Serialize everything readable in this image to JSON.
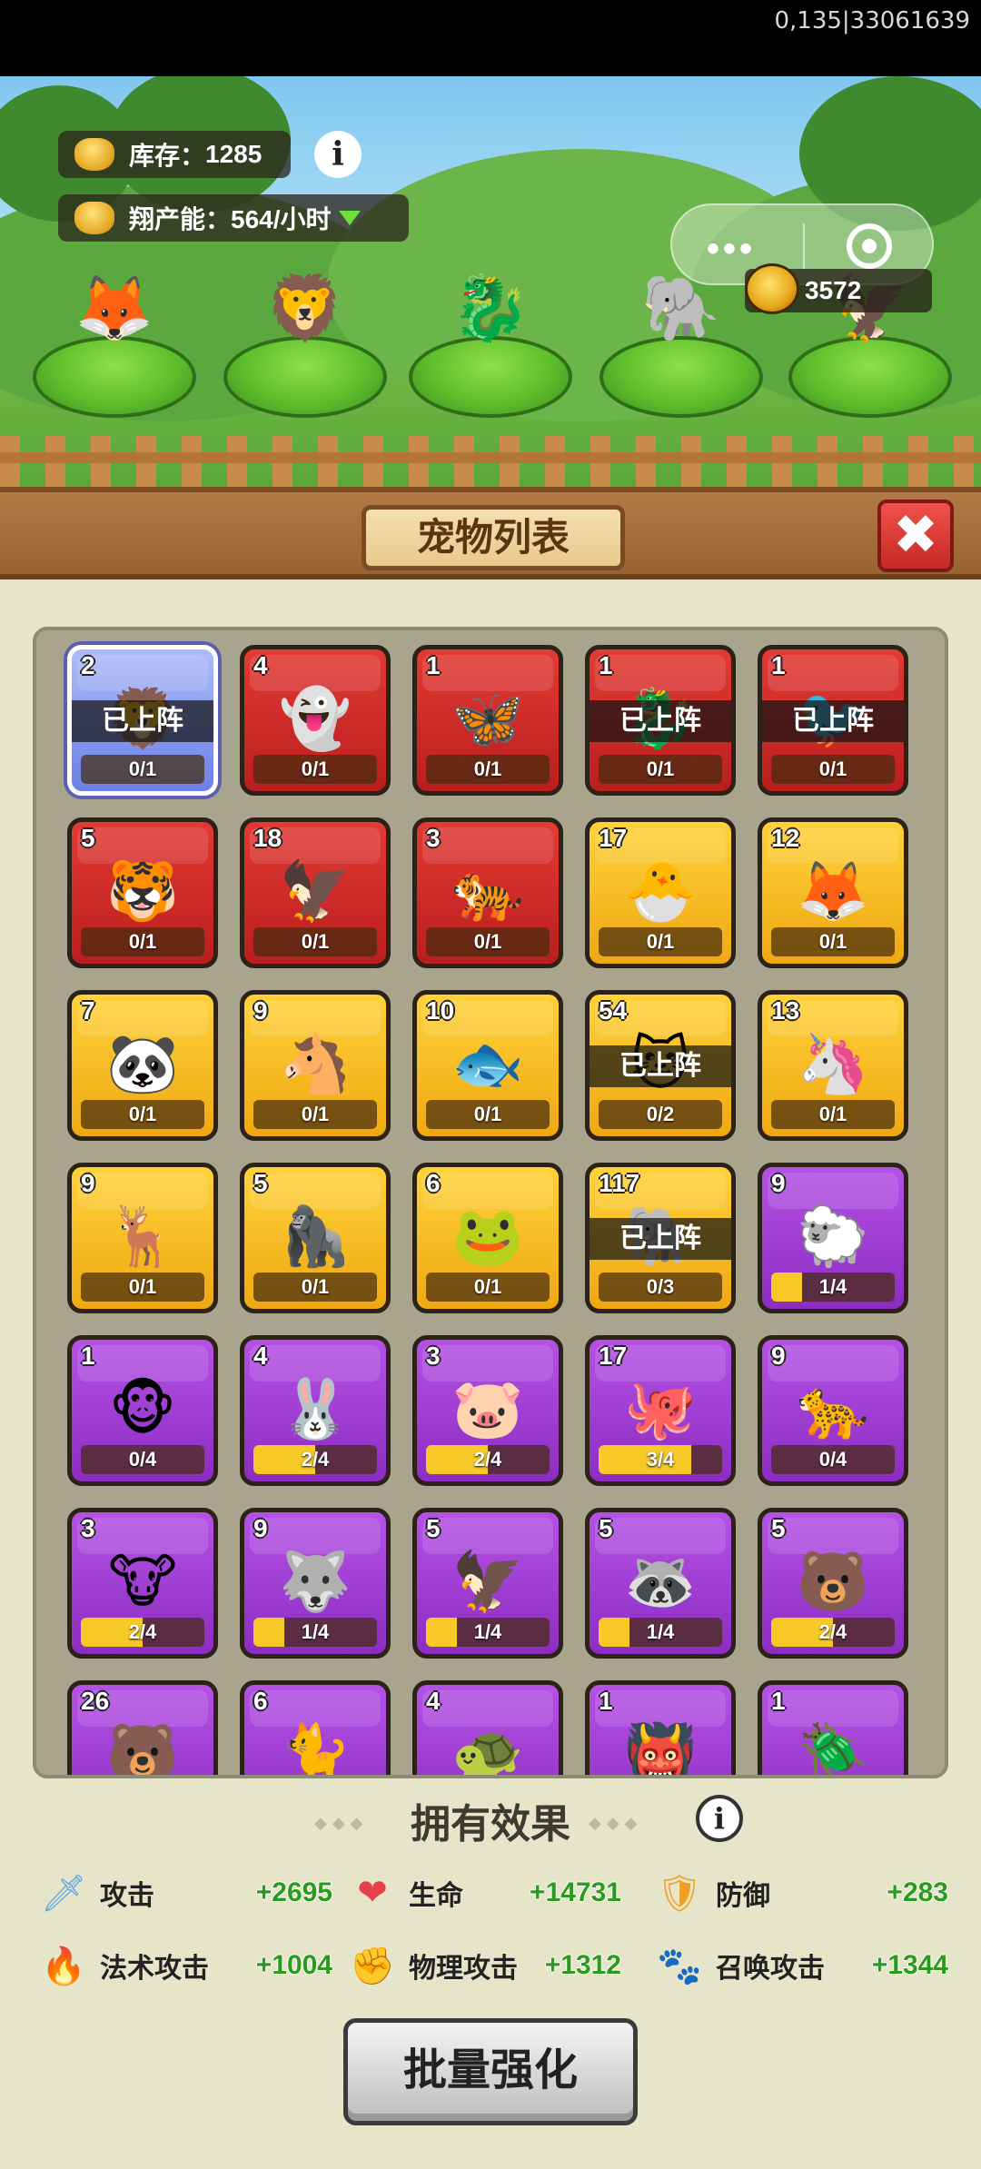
{
  "status_code": "0,135|33061639",
  "top": {
    "stock_label": "库存：",
    "stock_value": "1285",
    "capacity_label": "翔产能：",
    "capacity_value": "564/小时",
    "info_glyph": "i",
    "gold_value": "3572",
    "menu_dots": "•••"
  },
  "team": [
    {
      "icon": "fox-pet-icon",
      "glyph": "🦊"
    },
    {
      "icon": "lion-dance-pet-icon",
      "glyph": "🦁"
    },
    {
      "icon": "dragon-pet-icon",
      "glyph": "🐉"
    },
    {
      "icon": "elephant-pet-icon",
      "glyph": "🐘"
    },
    {
      "icon": "phoenix-pet-icon",
      "glyph": "🦅"
    }
  ],
  "panel": {
    "title": "宠物列表",
    "close_glyph": "✖"
  },
  "deployed_label": "已上阵",
  "pets": [
    {
      "level": "2",
      "progress": "0/1",
      "fill": 0.0,
      "color": "blue",
      "deployed": true,
      "icon": "lion-pet-icon",
      "glyph": "🦁"
    },
    {
      "level": "4",
      "progress": "0/1",
      "fill": 0.0,
      "color": "red",
      "deployed": false,
      "icon": "ghost-king-pet-icon",
      "glyph": "👻"
    },
    {
      "level": "1",
      "progress": "0/1",
      "fill": 0.0,
      "color": "red",
      "deployed": false,
      "icon": "butterfly-pet-icon",
      "glyph": "🦋"
    },
    {
      "level": "1",
      "progress": "0/1",
      "fill": 0.0,
      "color": "red",
      "deployed": true,
      "icon": "dragon-pet-icon",
      "glyph": "🐉"
    },
    {
      "level": "1",
      "progress": "0/1",
      "fill": 0.0,
      "color": "red",
      "deployed": true,
      "icon": "phoenix-pet-icon",
      "glyph": "🐦"
    },
    {
      "level": "5",
      "progress": "0/1",
      "fill": 0.0,
      "color": "red",
      "deployed": false,
      "icon": "beast-pet-icon",
      "glyph": "🐯"
    },
    {
      "level": "18",
      "progress": "0/1",
      "fill": 0.0,
      "color": "red",
      "deployed": false,
      "icon": "eagle-pet-icon",
      "glyph": "🦅"
    },
    {
      "level": "3",
      "progress": "0/1",
      "fill": 0.0,
      "color": "red",
      "deployed": false,
      "icon": "white-tiger-pet-icon",
      "glyph": "🐅"
    },
    {
      "level": "17",
      "progress": "0/1",
      "fill": 0.0,
      "color": "yellow",
      "deployed": false,
      "icon": "egg-chick-pet-icon",
      "glyph": "🐣"
    },
    {
      "level": "12",
      "progress": "0/1",
      "fill": 0.0,
      "color": "yellow",
      "deployed": false,
      "icon": "white-fox-pet-icon",
      "glyph": "🦊"
    },
    {
      "level": "7",
      "progress": "0/1",
      "fill": 0.0,
      "color": "yellow",
      "deployed": false,
      "icon": "panda-pet-icon",
      "glyph": "🐼"
    },
    {
      "level": "9",
      "progress": "0/1",
      "fill": 0.0,
      "color": "yellow",
      "deployed": false,
      "icon": "horse-pet-icon",
      "glyph": "🐴"
    },
    {
      "level": "10",
      "progress": "0/1",
      "fill": 0.0,
      "color": "yellow",
      "deployed": false,
      "icon": "fish-pet-icon",
      "glyph": "🐟"
    },
    {
      "level": "54",
      "progress": "0/2",
      "fill": 0.0,
      "color": "yellow",
      "deployed": true,
      "icon": "cat-pet-icon",
      "glyph": "🐱"
    },
    {
      "level": "13",
      "progress": "0/1",
      "fill": 0.0,
      "color": "yellow",
      "deployed": false,
      "icon": "unicorn-pet-icon",
      "glyph": "🦄"
    },
    {
      "level": "9",
      "progress": "0/1",
      "fill": 0.0,
      "color": "yellow",
      "deployed": false,
      "icon": "deer-pet-icon",
      "glyph": "🦌"
    },
    {
      "level": "5",
      "progress": "0/1",
      "fill": 0.0,
      "color": "yellow",
      "deployed": false,
      "icon": "gorilla-pet-icon",
      "glyph": "🦍"
    },
    {
      "level": "6",
      "progress": "0/1",
      "fill": 0.0,
      "color": "yellow",
      "deployed": false,
      "icon": "frog-pet-icon",
      "glyph": "🐸"
    },
    {
      "level": "117",
      "progress": "0/3",
      "fill": 0.0,
      "color": "yellow",
      "deployed": true,
      "icon": "elephant-pet-icon",
      "glyph": "🐘"
    },
    {
      "level": "9",
      "progress": "1/4",
      "fill": 0.25,
      "color": "purple",
      "deployed": false,
      "icon": "sheep-pet-icon",
      "glyph": "🐑"
    },
    {
      "level": "1",
      "progress": "0/4",
      "fill": 0.0,
      "color": "purple",
      "deployed": false,
      "icon": "monkey-pet-icon",
      "glyph": "🐵"
    },
    {
      "level": "4",
      "progress": "2/4",
      "fill": 0.5,
      "color": "purple",
      "deployed": false,
      "icon": "rabbit-pet-icon",
      "glyph": "🐰"
    },
    {
      "level": "3",
      "progress": "2/4",
      "fill": 0.5,
      "color": "purple",
      "deployed": false,
      "icon": "pig-pet-icon",
      "glyph": "🐷"
    },
    {
      "level": "17",
      "progress": "3/4",
      "fill": 0.75,
      "color": "purple",
      "deployed": false,
      "icon": "octopus-pet-icon",
      "glyph": "🐙"
    },
    {
      "level": "9",
      "progress": "0/4",
      "fill": 0.0,
      "color": "purple",
      "deployed": false,
      "icon": "leopard-pet-icon",
      "glyph": "🐆"
    },
    {
      "level": "3",
      "progress": "2/4",
      "fill": 0.5,
      "color": "purple",
      "deployed": false,
      "icon": "ox-pet-icon",
      "glyph": "🐮"
    },
    {
      "level": "9",
      "progress": "1/4",
      "fill": 0.25,
      "color": "purple",
      "deployed": false,
      "icon": "wolf-pet-icon",
      "glyph": "🐺"
    },
    {
      "level": "5",
      "progress": "1/4",
      "fill": 0.25,
      "color": "purple",
      "deployed": false,
      "icon": "bald-eagle-pet-icon",
      "glyph": "🦅"
    },
    {
      "level": "5",
      "progress": "1/4",
      "fill": 0.25,
      "color": "purple",
      "deployed": false,
      "icon": "raccoon-pet-icon",
      "glyph": "🦝"
    },
    {
      "level": "5",
      "progress": "2/4",
      "fill": 0.5,
      "color": "purple",
      "deployed": false,
      "icon": "red-panda-pet-icon",
      "glyph": "🐻"
    },
    {
      "level": "26",
      "progress": "",
      "fill": 0.0,
      "color": "purple",
      "deployed": false,
      "icon": "bear-pet-icon",
      "glyph": "🐻"
    },
    {
      "level": "6",
      "progress": "",
      "fill": 0.0,
      "color": "purple",
      "deployed": false,
      "icon": "tabby-cat-pet-icon",
      "glyph": "🐈"
    },
    {
      "level": "4",
      "progress": "",
      "fill": 0.0,
      "color": "purple",
      "deployed": false,
      "icon": "turtle-pet-icon",
      "glyph": "🐢"
    },
    {
      "level": "1",
      "progress": "",
      "fill": 0.0,
      "color": "purple",
      "deployed": false,
      "icon": "demon-pet-icon",
      "glyph": "👹"
    },
    {
      "level": "1",
      "progress": "",
      "fill": 0.0,
      "color": "purple",
      "deployed": false,
      "icon": "beetle-pet-icon",
      "glyph": "🪲"
    }
  ],
  "effects": {
    "title": "拥有效果",
    "info_glyph": "i",
    "stats": [
      {
        "name": "攻击",
        "value": "+2695",
        "icon": "sword-icon",
        "glyph": "🗡",
        "color": "#5aa6e8"
      },
      {
        "name": "生命",
        "value": "+14731",
        "icon": "heart-icon",
        "glyph": "❤",
        "color": "#e8404a"
      },
      {
        "name": "防御",
        "value": "+283",
        "icon": "shield-icon",
        "glyph": "🛡",
        "color": "#f0a020"
      },
      {
        "name": "法术攻击",
        "value": "+1004",
        "icon": "flame-icon",
        "glyph": "🔥",
        "color": "#2f8ae8"
      },
      {
        "name": "物理攻击",
        "value": "+1312",
        "icon": "claw-icon",
        "glyph": "✊",
        "color": "#d8302a"
      },
      {
        "name": "召唤攻击",
        "value": "+1344",
        "icon": "paw-icon",
        "glyph": "🐾",
        "color": "#b040e0"
      }
    ]
  },
  "bulk_button": "批量强化"
}
